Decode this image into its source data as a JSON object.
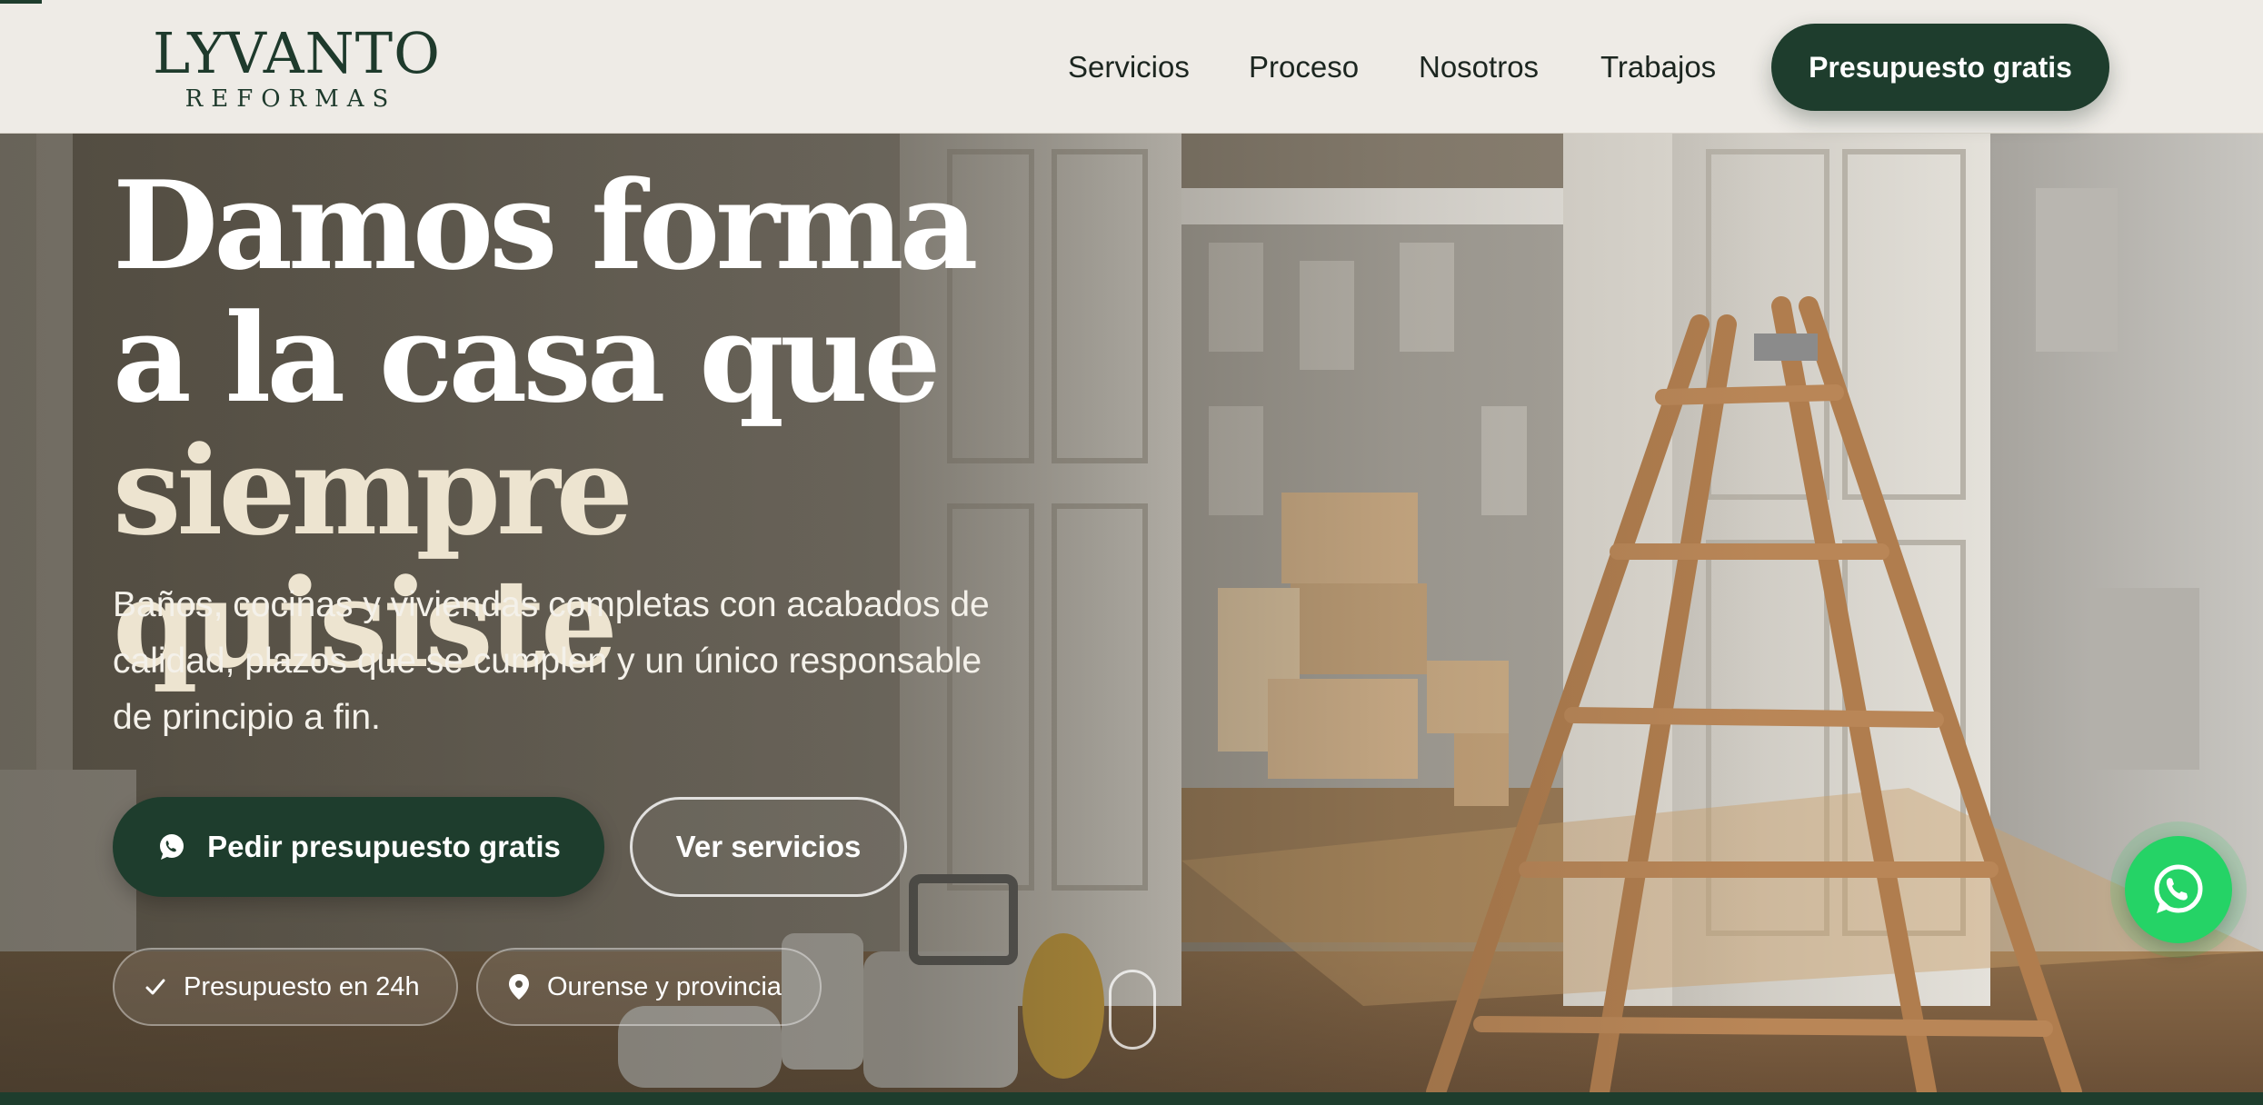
{
  "header": {
    "logo_main": "LYVANTO",
    "logo_sub": "REFORMAS",
    "nav": [
      "Servicios",
      "Proceso",
      "Nosotros",
      "Trabajos"
    ],
    "cta_label": "Presupuesto gratis"
  },
  "hero": {
    "headline": [
      "Damos forma",
      "a la casa que",
      "siempre quisiste"
    ],
    "subtitle": [
      "Baños, cocinas y viviendas completas con acabados de",
      "calidad, plazos que se cumplen y un único responsable",
      "de principio a fin."
    ],
    "primary_button": "Pedir presupuesto gratis",
    "secondary_button": "Ver servicios",
    "chips": [
      {
        "label": "Presupuesto en 24h",
        "icon": "check-icon"
      },
      {
        "label": "Ourense y provincia",
        "icon": "map-pin-icon"
      }
    ]
  },
  "floating": {
    "icon": "whatsapp-icon"
  },
  "colors": {
    "brand_green": "#1e3d2d",
    "header_bg": "#eeebe6",
    "whatsapp_green": "#25d366",
    "headline_cream": "#ede4d0"
  }
}
